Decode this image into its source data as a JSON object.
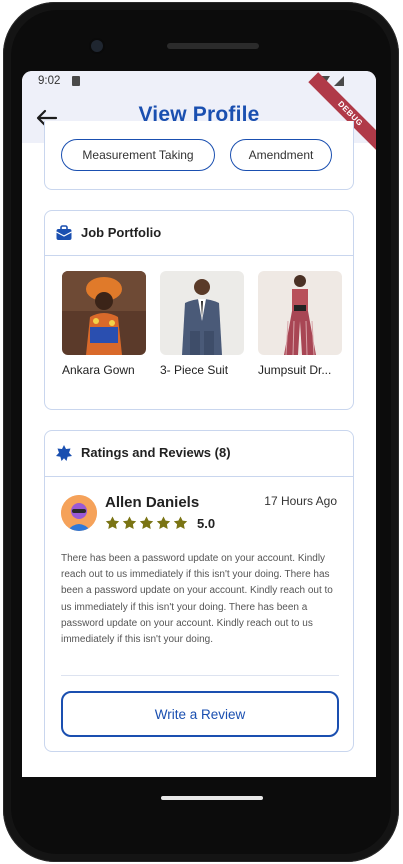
{
  "status_bar": {
    "time": "9:02"
  },
  "app_bar": {
    "title": "View Profile",
    "debug_banner": "DEBUG"
  },
  "services": {
    "chips": [
      {
        "label": "Measurement Taking"
      },
      {
        "label": "Amendment"
      }
    ]
  },
  "portfolio": {
    "title": "Job Portfolio",
    "items": [
      {
        "label": "Ankara Gown"
      },
      {
        "label": "3- Piece Suit"
      },
      {
        "label": "Jumpsuit Dr..."
      }
    ]
  },
  "reviews": {
    "title": "Ratings and Reviews (8)",
    "review": {
      "name": "Allen Daniels",
      "time": "17 Hours Ago",
      "rating": "5.0",
      "stars": 5,
      "text": "There has been a password update on your account. Kindly reach out to us immediately if this isn't your doing. There has been a password update on your account. Kindly reach out to us immediately if this isn't your doing. There has been a password update on your account. Kindly reach out to us immediately if this isn't your doing."
    },
    "write_button": "Write a Review"
  },
  "colors": {
    "brand": "#1a4fb0",
    "star": "#7a7414",
    "card_border": "#c9d6ee",
    "app_bar_bg": "#eef0f9"
  },
  "icons": [
    "back-arrow-icon",
    "portfolio-bag-icon",
    "star-badge-icon",
    "star-icon"
  ]
}
